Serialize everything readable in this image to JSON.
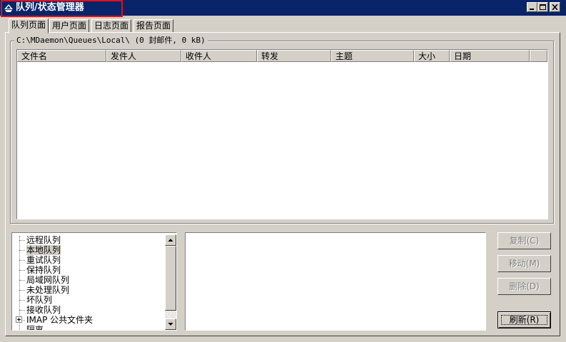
{
  "window": {
    "title": "队列/状态管理器",
    "colors": {
      "titlebar": "#0a246a",
      "highlight": "#e0101a",
      "face": "#d4d0c8"
    },
    "icons": [
      "app-icon",
      "minimize-icon",
      "maximize-icon",
      "close-icon"
    ]
  },
  "tabs": [
    {
      "label": "队列页面",
      "active": true
    },
    {
      "label": "用户页面",
      "active": false
    },
    {
      "label": "日志页面",
      "active": false
    },
    {
      "label": "报告页面",
      "active": false
    }
  ],
  "queue": {
    "path_label": "C:\\MDaemon\\Queues\\Local\\  (0 封邮件, 0 kB)",
    "columns": [
      "文件名",
      "发件人",
      "收件人",
      "转发",
      "主题",
      "大小",
      "日期"
    ]
  },
  "tree": {
    "items": [
      {
        "label": "远程队列",
        "selected": false,
        "expandable": false
      },
      {
        "label": "本地队列",
        "selected": true,
        "expandable": false
      },
      {
        "label": "重试队列",
        "selected": false,
        "expandable": false
      },
      {
        "label": "保持队列",
        "selected": false,
        "expandable": false
      },
      {
        "label": "局域网队列",
        "selected": false,
        "expandable": false
      },
      {
        "label": "未处理队列",
        "selected": false,
        "expandable": false
      },
      {
        "label": "坏队列",
        "selected": false,
        "expandable": false
      },
      {
        "label": "接收队列",
        "selected": false,
        "expandable": false
      },
      {
        "label": "IMAP 公共文件夹",
        "selected": false,
        "expandable": true
      },
      {
        "label": "隔离",
        "selected": false,
        "expandable": false
      }
    ]
  },
  "buttons": {
    "copy": "复制(C)",
    "move": "移动(M)",
    "delete": "删除(D)",
    "refresh": "刷新(R)"
  }
}
